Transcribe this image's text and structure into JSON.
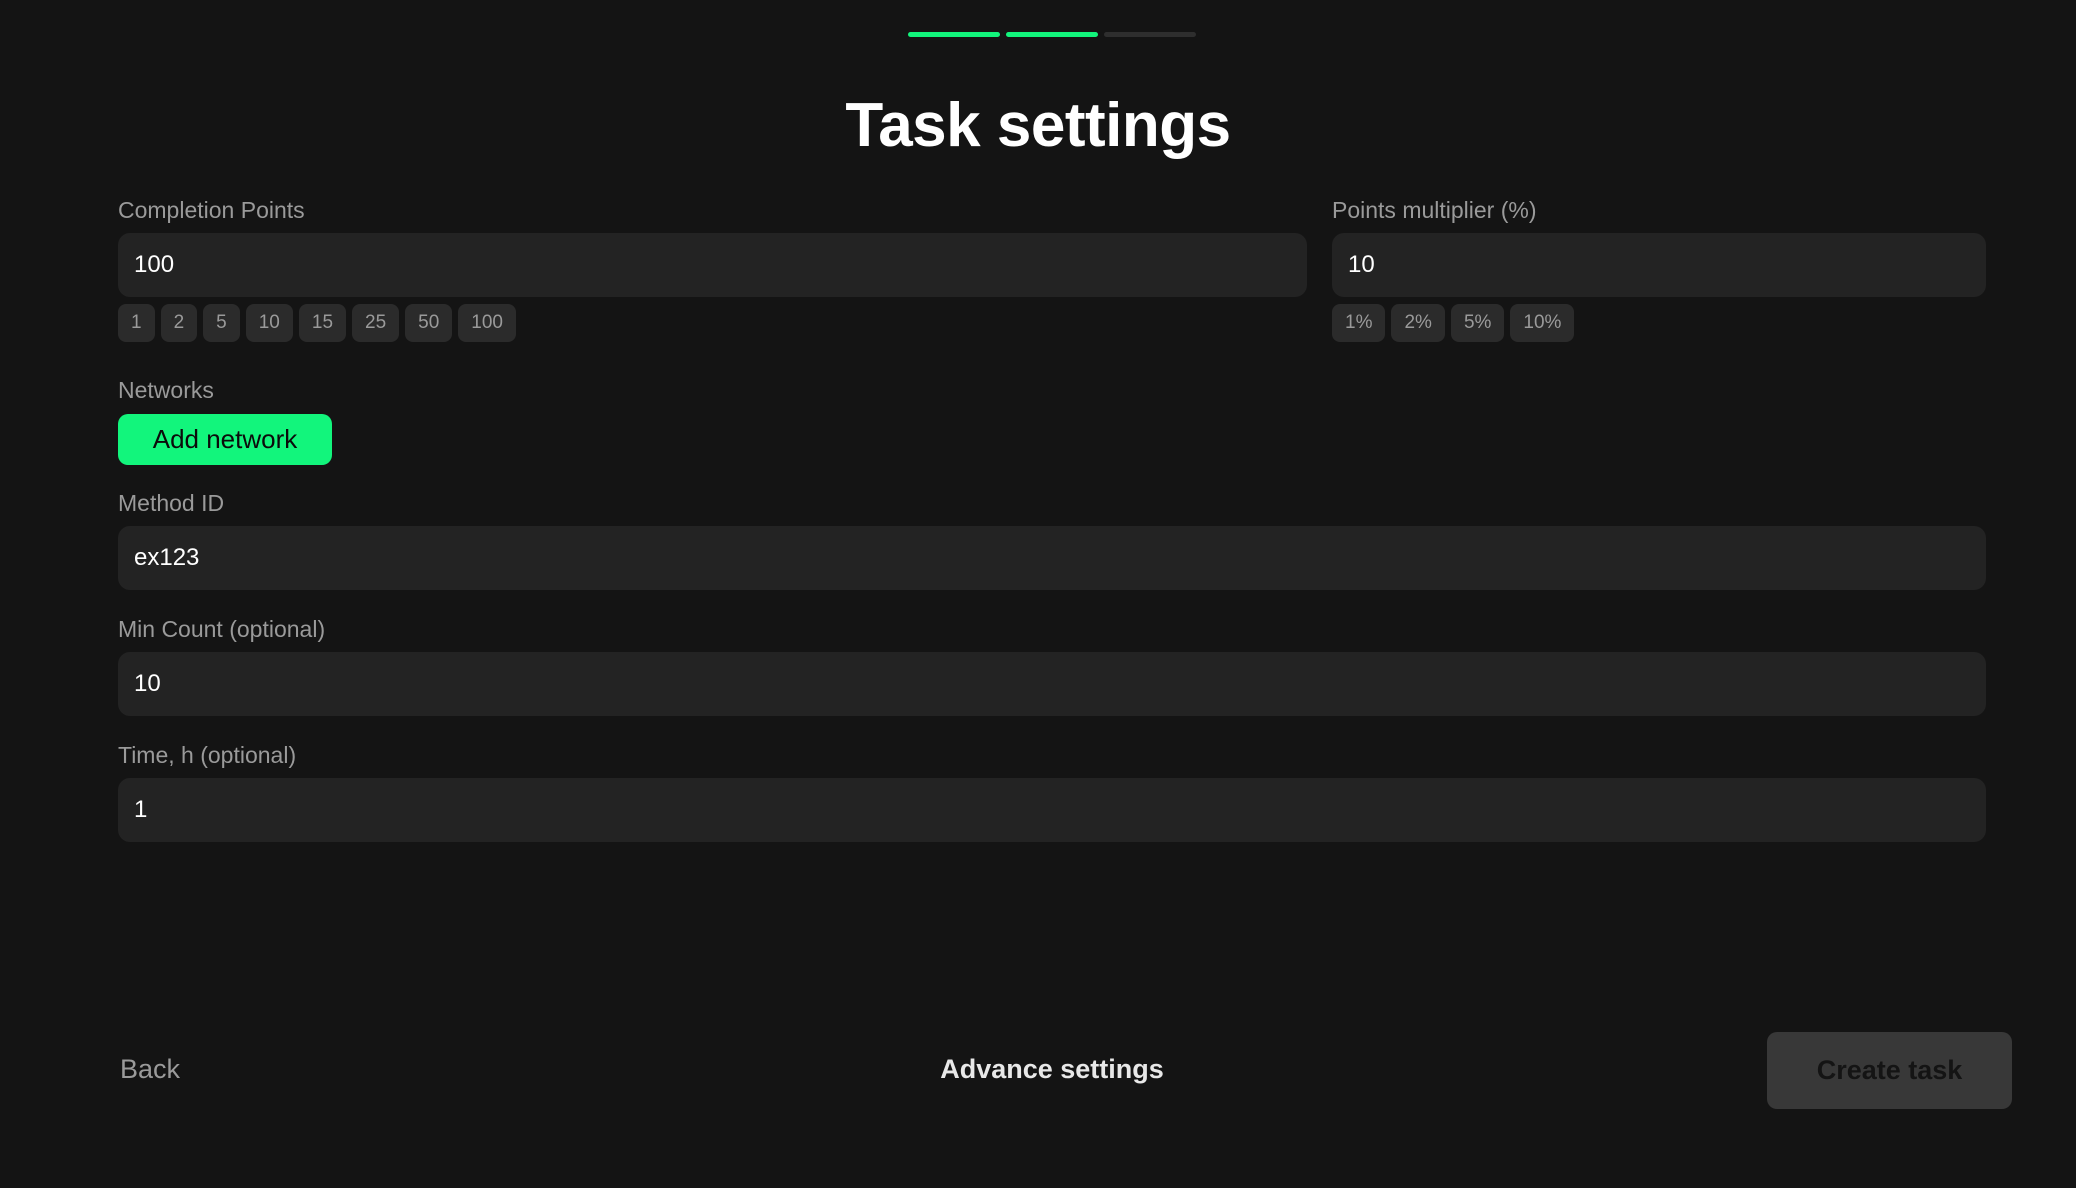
{
  "progress": {
    "steps_total": 3,
    "steps_completed": 2,
    "accent_color": "#12f57c"
  },
  "title": "Task settings",
  "completion_points": {
    "label": "Completion Points",
    "value": "100",
    "presets": [
      "1",
      "2",
      "5",
      "10",
      "15",
      "25",
      "50",
      "100"
    ]
  },
  "points_multiplier": {
    "label": "Points multiplier (%)",
    "value": "10",
    "presets": [
      "1%",
      "2%",
      "5%",
      "10%"
    ]
  },
  "networks": {
    "label": "Networks",
    "add_button": "Add network"
  },
  "method_id": {
    "label": "Method ID",
    "value": "ex123"
  },
  "min_count": {
    "label": "Min Count (optional)",
    "value": "10"
  },
  "time": {
    "label": "Time, h (optional)",
    "value": "1"
  },
  "footer": {
    "back": "Back",
    "advance": "Advance settings",
    "create": "Create task"
  }
}
